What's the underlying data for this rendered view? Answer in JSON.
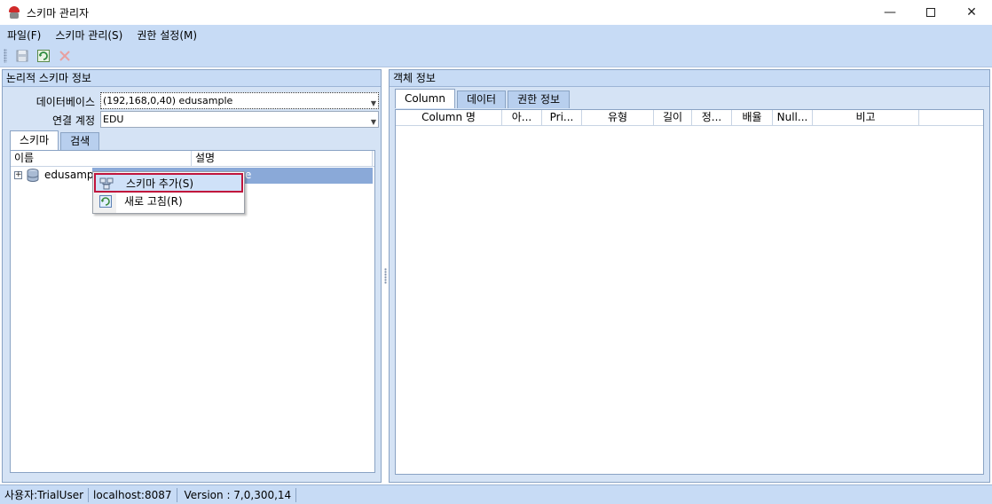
{
  "window": {
    "title": "스키마 관리자",
    "minimize_glyph": "—",
    "close_glyph": "✕"
  },
  "menu": {
    "items": [
      "파일(F)",
      "스키마 관리(S)",
      "권한 설정(M)"
    ]
  },
  "toolbar": {
    "buttons": [
      "save-icon",
      "refresh-icon",
      "delete-icon"
    ]
  },
  "left_pane": {
    "header": "논리적 스키마 정보",
    "database_label": "데이터베이스",
    "database_value": "(192,168,0,40) edusample",
    "account_label": "연결 계정",
    "account_value": "EDU",
    "tabs": [
      "스키마",
      "검색"
    ],
    "columns": [
      "이름",
      "설명"
    ],
    "tree": {
      "name": "edusamp",
      "desc": "e"
    }
  },
  "context_menu": {
    "items": [
      "스키마 추가(S)",
      "새로 고침(R)"
    ]
  },
  "right_pane": {
    "header": "객체 정보",
    "tabs": [
      "Column",
      "데이터",
      "권한 정보"
    ],
    "columns": [
      "Column 명",
      "아...",
      "Pri...",
      "유형",
      "길이",
      "정...",
      "배율",
      "Null...",
      "비고"
    ]
  },
  "status": {
    "user": "사용자:TrialUser",
    "host": "localhost:8087",
    "version": "Version : 7,0,300,14"
  },
  "colors": {
    "chrome": "#c7dbf5",
    "selection": "#8aa9d8",
    "highlight_border": "#c0143c"
  }
}
